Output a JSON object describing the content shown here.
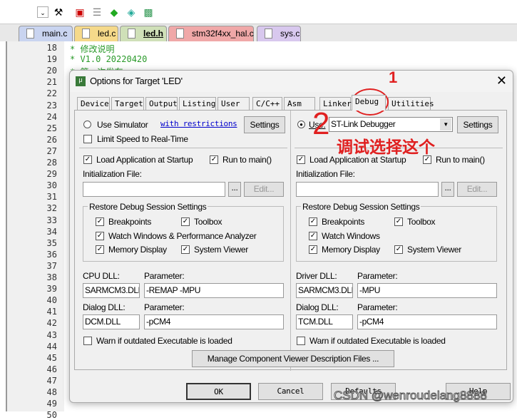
{
  "file_tabs": [
    {
      "label": "main.c",
      "color": "#c9d4f0"
    },
    {
      "label": "led.c",
      "color": "#f5d98a"
    },
    {
      "label": "led.h",
      "color": "#cfe0b8",
      "active": true
    },
    {
      "label": "stm32f4xx_hal.c",
      "color": "#f0a8a8"
    },
    {
      "label": "sys.c",
      "color": "#d8c8ee"
    }
  ],
  "editor": {
    "line_numbers": [
      "18",
      "19",
      "20",
      "21",
      "22",
      "23",
      "24",
      "25",
      "26",
      "27",
      "28",
      "29",
      "30",
      "31",
      "32",
      "33",
      "34",
      "35",
      "36",
      "37",
      "38",
      "39",
      "40",
      "41",
      "42",
      "43",
      "44",
      "45",
      "46",
      "47",
      "48",
      "49",
      "50"
    ],
    "visible_code": {
      "18": "* 修改说明",
      "19": "* V1.0 20220420",
      "20": "* 第一次发布",
      "24": "#",
      "25": "#",
      "27": "#",
      "29": "/",
      "30": "/",
      "32": "#",
      "33": "#",
      "34": "#",
      "36": "#",
      "37": "#",
      "38": "#",
      "40": "/",
      "42": "/",
      "43": "#",
      "48": "#"
    }
  },
  "dialog": {
    "title": "Options for Target 'LED'",
    "tabs": [
      "Device",
      "Target",
      "Output",
      "Listing",
      "User",
      "C/C++",
      "Asm",
      "Linker",
      "Debug",
      "Utilities"
    ],
    "active_tab": "Debug",
    "left": {
      "use_simulator": "Use Simulator",
      "with_restrictions": "with restrictions",
      "settings": "Settings",
      "limit_speed": "Limit Speed to Real-Time",
      "load_app": "Load Application at Startup",
      "run_to_main": "Run to main()",
      "init_file_label": "Initialization File:",
      "init_file": "",
      "browse": "...",
      "edit": "Edit...",
      "restore_title": "Restore Debug Session Settings",
      "breakpoints": "Breakpoints",
      "toolbox": "Toolbox",
      "watch": "Watch Windows & Performance Analyzer",
      "memory": "Memory Display",
      "system_viewer": "System Viewer",
      "cpu_dll_label": "CPU DLL:",
      "parameter_label": "Parameter:",
      "cpu_dll": "SARMCM3.DLL",
      "cpu_param": "-REMAP -MPU",
      "dialog_dll_label": "Dialog DLL:",
      "dialog_dll": "DCM.DLL",
      "dialog_param": "-pCM4",
      "warn": "Warn if outdated Executable is loaded"
    },
    "right": {
      "use": "Use:",
      "debugger": "ST-Link Debugger",
      "settings": "Settings",
      "load_app": "Load Application at Startup",
      "run_to_main": "Run to main()",
      "init_file_label": "Initialization File:",
      "init_file": "",
      "browse": "...",
      "edit": "Edit...",
      "restore_title": "Restore Debug Session Settings",
      "breakpoints": "Breakpoints",
      "toolbox": "Toolbox",
      "watch": "Watch Windows",
      "memory": "Memory Display",
      "system_viewer": "System Viewer",
      "driver_dll_label": "Driver DLL:",
      "parameter_label": "Parameter:",
      "driver_dll": "SARMCM3.DLL",
      "driver_param": "-MPU",
      "dialog_dll_label": "Dialog DLL:",
      "dialog_dll": "TCM.DLL",
      "dialog_param": "-pCM4",
      "warn": "Warn if outdated Executable is loaded"
    },
    "manage_btn": "Manage Component Viewer Description Files ...",
    "ok": "OK",
    "cancel": "Cancel",
    "defaults": "Defaults",
    "help": "Help"
  },
  "annotations": {
    "num1": "1",
    "num2": "2",
    "note": "调试选择这个",
    "color": "#e02020"
  },
  "watermark": "CSDN @wenroudelang8888"
}
